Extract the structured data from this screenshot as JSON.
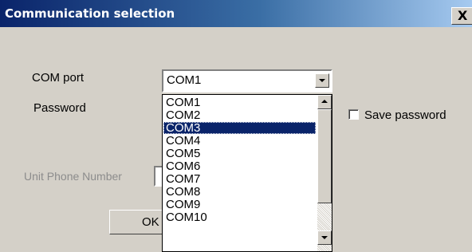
{
  "window": {
    "title": "Communication selection",
    "close_label": "X"
  },
  "form": {
    "com_port_label": "COM port",
    "com_port_value": "COM1",
    "password_label": "Password",
    "save_password_label": "Save password",
    "save_password_checked": false,
    "unit_phone_label": "Unit Phone Number",
    "ok_label": "OK"
  },
  "dropdown": {
    "items": [
      "COM1",
      "COM2",
      "COM3",
      "COM4",
      "COM5",
      "COM6",
      "COM7",
      "COM8",
      "COM9",
      "COM10"
    ],
    "highlighted": "COM3"
  },
  "colors": {
    "title_start": "#0a246a",
    "title_end": "#a6caf0",
    "face": "#d4d0c8",
    "highlight": "#0a246a"
  }
}
